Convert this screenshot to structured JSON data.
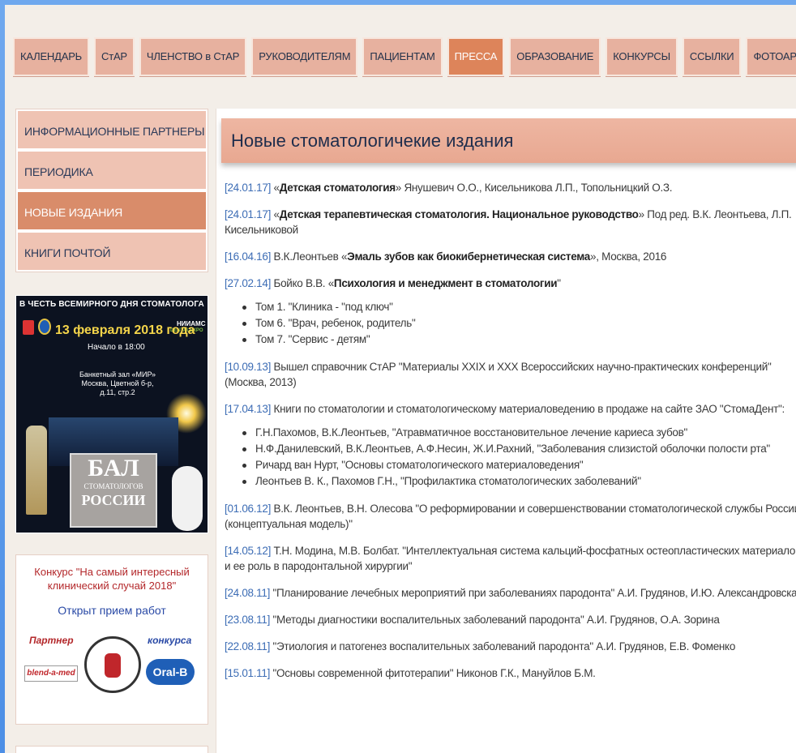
{
  "nav": [
    {
      "label": "КАЛЕНДАРЬ"
    },
    {
      "label": "СтАР"
    },
    {
      "label": "ЧЛЕНСТВО в СтАР"
    },
    {
      "label": "РУКОВОДИТЕЛЯМ"
    },
    {
      "label": "ПАЦИЕНТАМ"
    },
    {
      "label": "ПРЕССА"
    },
    {
      "label": "ОБРАЗОВАНИЕ"
    },
    {
      "label": "КОНКУРСЫ"
    },
    {
      "label": "ССЫЛКИ"
    },
    {
      "label": "ФОТОАРХИВ"
    }
  ],
  "sidebar": {
    "items": [
      {
        "label": "ИНФОРМАЦИОННЫЕ ПАРТНЕРЫ"
      },
      {
        "label": "ПЕРИОДИКА"
      },
      {
        "label": "НОВЫЕ ИЗДАНИЯ"
      },
      {
        "label": "КНИГИ ПОЧТОЙ"
      }
    ],
    "banner1": {
      "head": "В ЧЕСТЬ ВСЕМИРНОГО ДНЯ СТОМАТОЛОГА",
      "date": "13 февраля 2018 года",
      "start": "Начало в 18:00",
      "venue": "Банкетный зал «МИР» Москва, Цветной б-р, д.11, стр.2",
      "logo_right": "НИИАМС",
      "logo_right2": "DENTALEXPO",
      "sign_big": "БАЛ",
      "sign_small": "СТОМАТОЛОГОВ",
      "sign_mid": "РОССИИ"
    },
    "banner2": {
      "title": "Конкурс \"На самый интересный клинический случай 2018\"",
      "open": "Открыт прием работ",
      "partner": "Партнер",
      "contest": "конкурса",
      "blend": "blend-a-med",
      "oral": "Oral-B"
    }
  },
  "main": {
    "title": "Новые стоматологичекие издания",
    "entries": [
      {
        "date": "[24.01.17]",
        "parts": [
          "«",
          "Детская стоматология",
          "» Янушевич О.О., Кисельникова Л.П., Топольницкий О.З."
        ]
      },
      {
        "date": "[24.01.17]",
        "parts": [
          "«",
          "Детская терапевтическая стоматология. Национальное руководство",
          "» Под ред. В.К. Леонтьева, Л.П. Кисельниковой"
        ]
      },
      {
        "date": "[16.04.16]",
        "parts": [
          "В.К.Леонтьев «",
          "Эмаль зубов как биокибернетическая система",
          "», Москва, 2016"
        ]
      },
      {
        "date": "[27.02.14]",
        "parts": [
          "Бойко В.В. «",
          "Психология и менеджмент в стоматологии",
          "\""
        ]
      }
    ],
    "list1": [
      "Том 1. \"Клиника - \"под ключ\"",
      "Том 6. \"Врач, ребенок, родитель\"",
      "Том 7. \"Сервис - детям\""
    ],
    "entry5": {
      "date": "[10.09.13]",
      "text": "Вышел справочник СтАР \"Материалы XXIX и XXX Всероссийских научно-практических конференций\" (Москва, 2013)"
    },
    "entry6": {
      "date": "[17.04.13]",
      "text": "Книги по стоматологии и стоматологическому материаловедению в продаже на сайте ЗАО \"СтомаДент\":"
    },
    "list2": [
      "Г.Н.Пахомов, В.К.Леонтьев, \"Атравматичное восстановительное лечение кариеса зубов\"",
      "Н.Ф.Данилевский, В.К.Леонтьев, А.Ф.Несин, Ж.И.Рахний, \"Заболевания слизистой оболочки полости рта\"",
      "Ричард ван Нурт, \"Основы стоматологического материаловедения\"",
      "Леонтьев В. К., Пахомов Г.Н., \"Профилактика стоматологических заболеваний\""
    ],
    "rest": [
      {
        "date": "[01.06.12]",
        "text": "В.К. Леонтьев, В.Н. Олесова \"О реформировании и совершенствовании стоматологической службы России (концептуальная модель)\""
      },
      {
        "date": "[14.05.12]",
        "text": "Т.Н. Модина, М.В. Болбат. \"Интеллектуальная система кальций-фосфатных остеопластических материалов и ее роль в пародонтальной хирургии\""
      },
      {
        "date": "[24.08.11]",
        "text": "\"Планирование лечебных мероприятий при заболеваниях пародонта\" А.И. Грудянов, И.Ю. Александровска"
      },
      {
        "date": "[23.08.11]",
        "text": "\"Методы диагностики воспалительных заболеваний пародонта\" А.И. Грудянов, О.А. Зорина"
      },
      {
        "date": "[22.08.11]",
        "text": "\"Этиология и патогенез воспалительных заболеваний пародонта\" А.И. Грудянов, Е.В. Фоменко"
      },
      {
        "date": "[15.01.11]",
        "text": "\"Основы современной фитотерапии\" Никонов Г.К., Мануйлов Б.М."
      }
    ]
  }
}
